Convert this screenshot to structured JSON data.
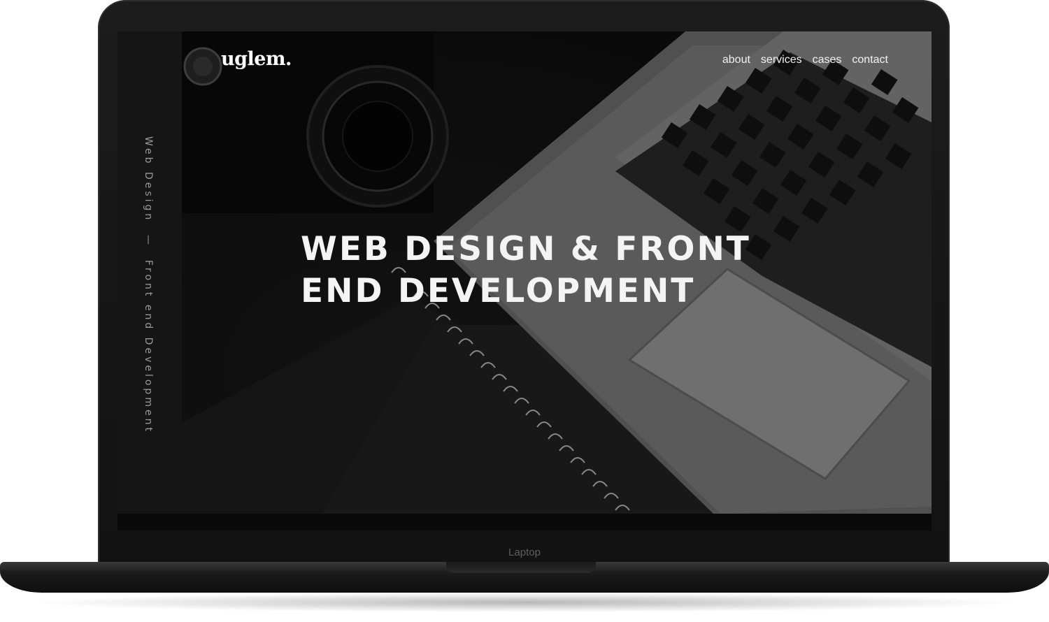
{
  "device": {
    "label": "Laptop",
    "frame_color": "#151515"
  },
  "site": {
    "logo": "uglem.",
    "nav": [
      {
        "label": "about"
      },
      {
        "label": "services"
      },
      {
        "label": "cases"
      },
      {
        "label": "contact"
      }
    ],
    "sidebar_tagline": {
      "part1": "Web Design",
      "separator": "—",
      "part2": "Front end Development"
    },
    "hero": {
      "title": "WEB DESIGN & FRONT END DEVELOPMENT",
      "background_image": "camera-laptop-notebook-photo"
    },
    "colors": {
      "text": "#ffffff",
      "sidebar_bg": "#151515",
      "hero_bg": "#111111"
    }
  }
}
